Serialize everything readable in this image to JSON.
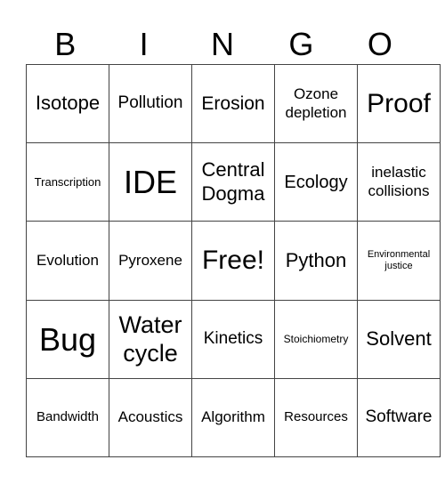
{
  "header": {
    "letters": [
      "B",
      "I",
      "N",
      "G",
      "O"
    ]
  },
  "grid": {
    "rows": [
      [
        "Isotope",
        "Pollution",
        "Erosion",
        "Ozone depletion",
        "Proof"
      ],
      [
        "Transcription",
        "IDE",
        "Central Dogma",
        "Ecology",
        "inelastic collisions"
      ],
      [
        "Evolution",
        "Pyroxene",
        "Free!",
        "Python",
        "Environmental justice"
      ],
      [
        "Bug",
        "Water cycle",
        "Kinetics",
        "Stoichiometry",
        "Solvent"
      ],
      [
        "Bandwidth",
        "Acoustics",
        "Algorithm",
        "Resources",
        "Software"
      ]
    ]
  }
}
